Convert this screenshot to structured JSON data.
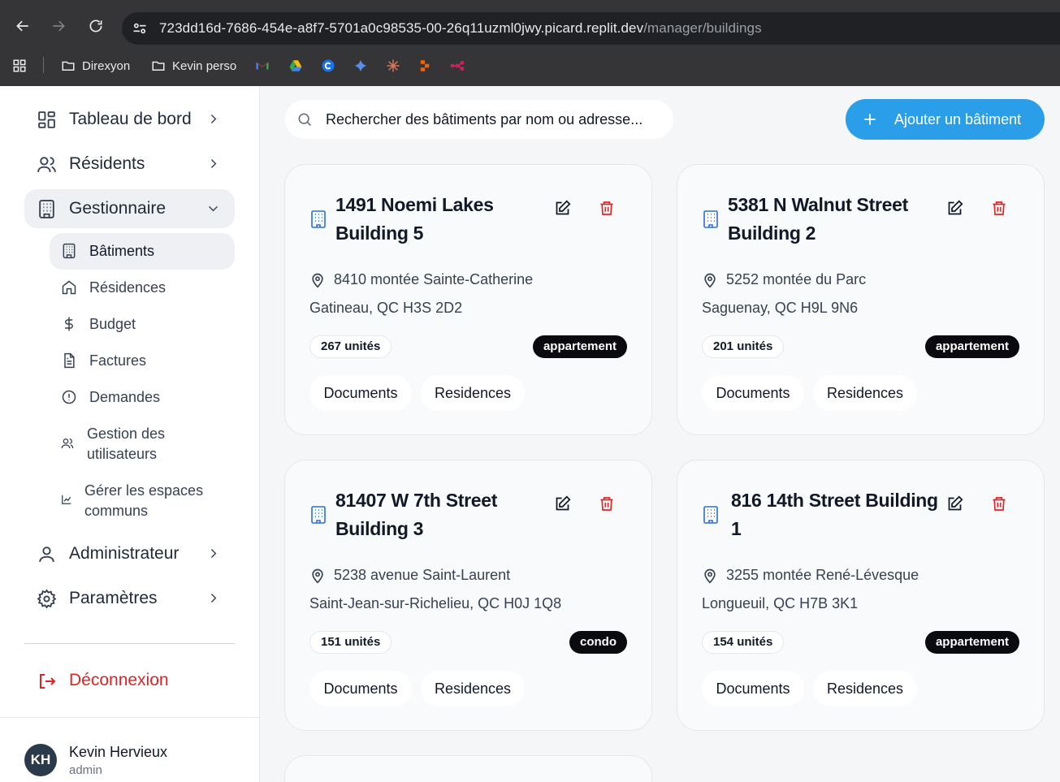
{
  "browser": {
    "url_host": "723dd16d-7686-454e-a8f7-5701a0c98535-00-26q11uzml0jwy.picard.replit.dev",
    "url_path": "/manager/buildings",
    "bookmarks": [
      "Direxyon",
      "Kevin perso"
    ]
  },
  "sidebar": {
    "items": [
      {
        "label": "Tableau de bord"
      },
      {
        "label": "Résidents"
      },
      {
        "label": "Gestionnaire"
      },
      {
        "label": "Administrateur"
      },
      {
        "label": "Paramètres"
      }
    ],
    "sub_items": [
      {
        "label": "Bâtiments"
      },
      {
        "label": "Résidences"
      },
      {
        "label": "Budget"
      },
      {
        "label": "Factures"
      },
      {
        "label": "Demandes"
      },
      {
        "label": "Gestion des utilisateurs"
      },
      {
        "label": "Gérer les espaces communs"
      }
    ],
    "logout": "Déconnexion",
    "user": {
      "initials": "KH",
      "name": "Kevin Hervieux",
      "role": "admin"
    }
  },
  "search": {
    "placeholder": "Rechercher des bâtiments par nom ou adresse..."
  },
  "add_button": "Ajouter un bâtiment",
  "colors": {
    "accent": "#2b9eea",
    "danger": "#dc2626",
    "building_icon": "#2b6fd6"
  },
  "buildings": [
    {
      "title": "1491 Noemi Lakes Building 5",
      "address": "8410 montée Sainte-Catherine",
      "city": "Gatineau, QC H3S 2D2",
      "units": "267 unités",
      "type": "appartement",
      "docs": "Documents",
      "res": "Residences"
    },
    {
      "title": "5381 N Walnut Street Building 2",
      "address": "5252 montée du Parc",
      "city": "Saguenay, QC H9L 9N6",
      "units": "201 unités",
      "type": "appartement",
      "docs": "Documents",
      "res": "Residences"
    },
    {
      "title": "81407 W 7th Street Building 3",
      "address": "5238 avenue Saint-Laurent",
      "city": "Saint-Jean-sur-Richelieu, QC H0J 1Q8",
      "units": "151 unités",
      "type": "condo",
      "docs": "Documents",
      "res": "Residences"
    },
    {
      "title": "816 14th Street Building 1",
      "address": "3255 montée René-Lévesque",
      "city": "Longueuil, QC H7B 3K1",
      "units": "154 unités",
      "type": "appartement",
      "docs": "Documents",
      "res": "Residences"
    }
  ]
}
